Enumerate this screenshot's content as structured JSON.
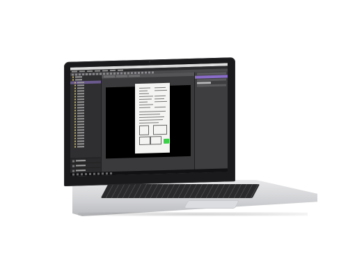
{
  "scene": {
    "device": "laptop"
  },
  "app": {
    "menu": [
      "",
      "",
      "",
      "",
      "",
      "",
      ""
    ],
    "toolbar_count": 24,
    "left_tree_rows": 26,
    "layers": [
      "",
      "",
      "",
      "",
      ""
    ],
    "doc_tabs": [
      "",
      "",
      ""
    ],
    "right_panel_rows": 3
  },
  "icons": {
    "stamp": "green-stamp-icon",
    "camera": "webcam-icon"
  },
  "colors": {
    "accent": "#8a6cc9",
    "stamp": "#3ecf4a",
    "canvas": "#000000",
    "page": "#f4f4f2"
  }
}
